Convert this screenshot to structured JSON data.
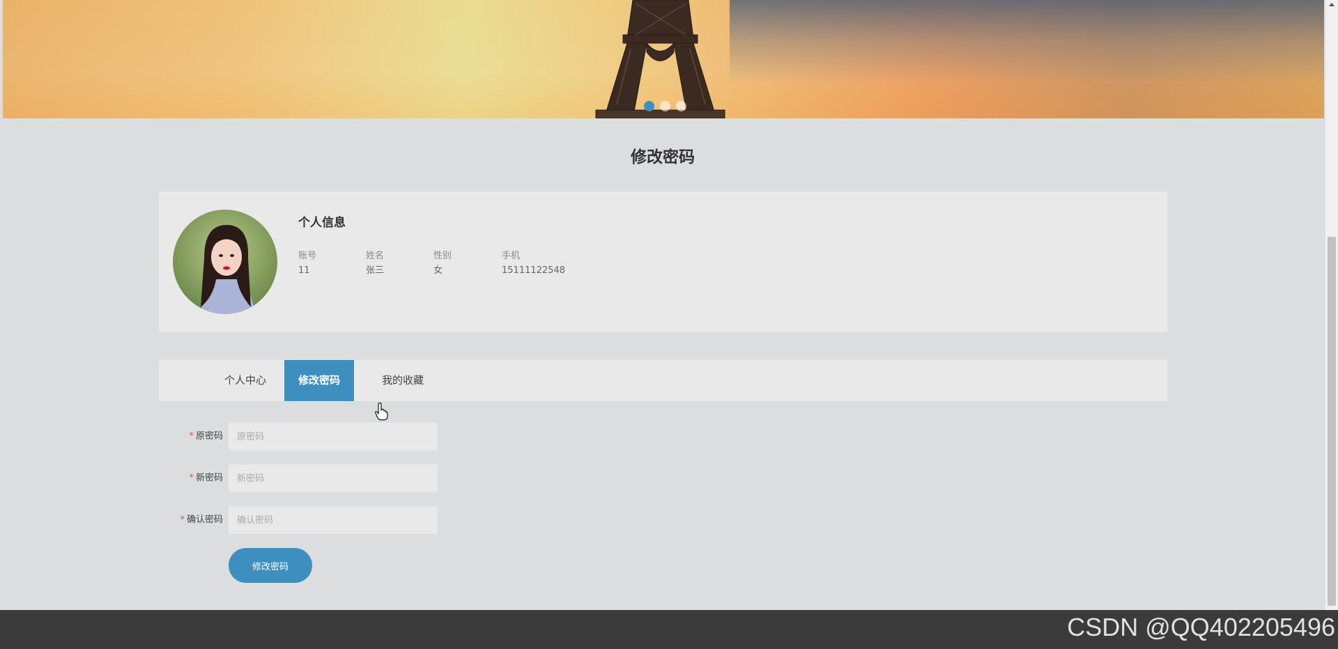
{
  "page": {
    "title": "修改密码"
  },
  "banner": {
    "active_slide": 1,
    "slide_count": 3
  },
  "profile": {
    "heading": "个人信息",
    "fields": [
      {
        "label": "账号",
        "value": "11"
      },
      {
        "label": "姓名",
        "value": "张三"
      },
      {
        "label": "性别",
        "value": "女"
      },
      {
        "label": "手机",
        "value": "15111122548"
      }
    ]
  },
  "tabs": [
    {
      "label": "个人中心",
      "active": false
    },
    {
      "label": "修改密码",
      "active": true
    },
    {
      "label": "我的收藏",
      "active": false
    }
  ],
  "form": {
    "required_mark": "*",
    "old_password": {
      "label": "原密码",
      "placeholder": "原密码"
    },
    "new_password": {
      "label": "新密码",
      "placeholder": "新密码"
    },
    "confirm_password": {
      "label": "确认密码",
      "placeholder": "确认密码"
    },
    "submit_label": "修改密码"
  },
  "watermark": "CSDN @QQ402205496",
  "colors": {
    "accent": "#3d8fc0",
    "required": "#d9534f",
    "footer": "#3b3b3b",
    "background": "#dcdddf"
  }
}
